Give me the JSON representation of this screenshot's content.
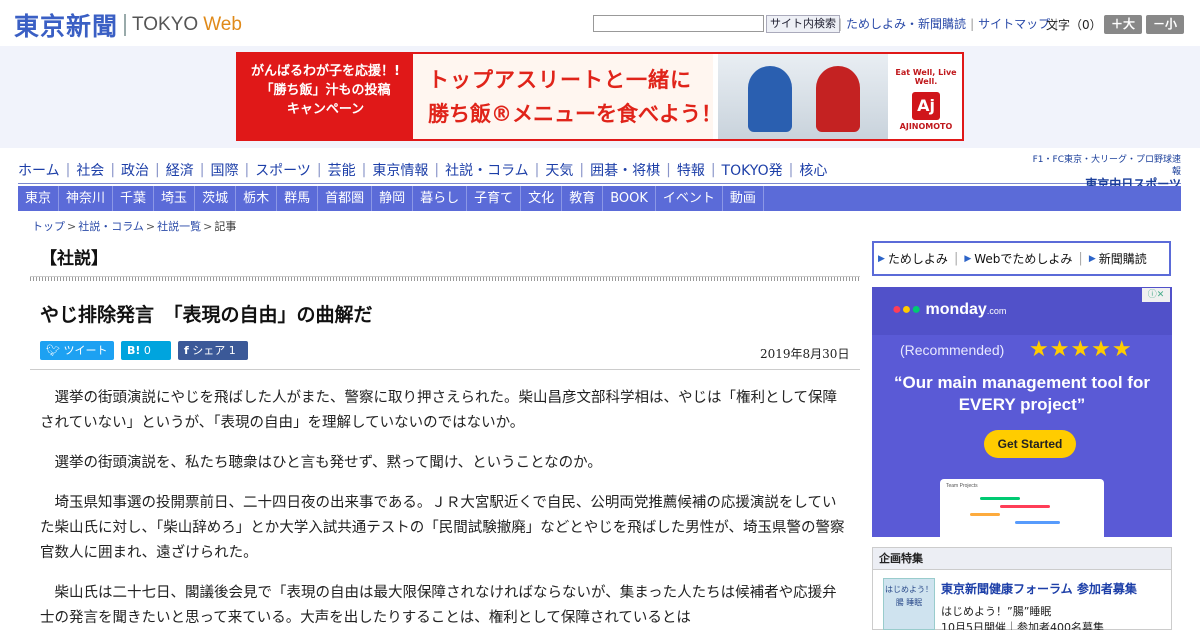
{
  "header": {
    "logo_jp": "東京新聞",
    "logo_en": "TOKYO",
    "logo_web": "Web",
    "search_button": "サイト内検索",
    "links": [
      "ためしよみ・新聞購読",
      "サイトマップ"
    ],
    "font_label": "文字（0）",
    "font_up": "＋大",
    "font_down": "－小"
  },
  "banner": {
    "left_lines": [
      "がんばるわが子を応援！!",
      "「勝ち飯」汁もの投稿",
      "キャンペーン"
    ],
    "headline": "トップアスリートと一緒に",
    "subline": "勝ち飯®メニューを食べよう！",
    "brand_slogan": "Eat Well, Live Well.",
    "brand_mark": "Aj",
    "brand_name": "AJINOMOTO"
  },
  "nav_primary": [
    "ホーム",
    "社会",
    "政治",
    "経済",
    "国際",
    "スポーツ",
    "芸能",
    "東京情報",
    "社説・コラム",
    "天気",
    "囲碁・将棋",
    "特報",
    "TOKYO発",
    "核心"
  ],
  "partner": {
    "line1": "F1・FC東京・大リーグ・プロ野球速報",
    "logo": "東京中日スポーツ"
  },
  "nav_secondary": [
    "東京",
    "神奈川",
    "千葉",
    "埼玉",
    "茨城",
    "栃木",
    "群馬",
    "首都圏",
    "静岡",
    "暮らし",
    "子育て",
    "文化",
    "教育",
    "BOOK",
    "イベント",
    "動画"
  ],
  "breadcrumb": [
    "トップ",
    "社説・コラム",
    "社説一覧",
    "記事"
  ],
  "article": {
    "section": "【社説】",
    "title": "やじ排除発言　「表現の自由」の曲解だ",
    "tweet_label": "ツイート",
    "hatena_label": "B!",
    "hatena_count": "0",
    "facebook_label": "シェア",
    "facebook_count": "1",
    "date": "2019年8月30日",
    "paragraphs": [
      "選挙の街頭演説にやじを飛ばした人がまた、警察に取り押さえられた。柴山昌彦文部科学相は、やじは「権利として保障されていない」というが、「表現の自由」を理解していないのではないか。",
      "選挙の街頭演説を、私たち聴衆はひと言も発せず、黙って聞け、ということなのか。",
      "埼玉県知事選の投開票前日、二十四日夜の出来事である。ＪＲ大宮駅近くで自民、公明両党推薦候補の応援演説をしていた柴山氏に対し、「柴山辞めろ」とか大学入試共通テストの「民間試験撤廃」などとやじを飛ばした男性が、埼玉県警の警察官数人に囲まれ、遠ざけられた。",
      "柴山氏は二十七日、閣議後会見で「表現の自由は最大限保障されなければならないが、集まった人たちは候補者や応援弁士の発言を聞きたいと思って来ている。大声を出したりすることは、権利として保障されているとは"
    ]
  },
  "sidebar": {
    "sub_links": [
      "ためしよみ",
      "Webでためしよみ",
      "新聞購読"
    ],
    "ad": {
      "logo": "monday",
      "logo_suffix": ".com",
      "recommended": "(Recommended)",
      "stars": "★★★★★",
      "quote": "“Our main management tool for EVERY project”",
      "button": "Get Started",
      "card_title": "Team Projects"
    },
    "feature": {
      "heading": "企画特集",
      "thumb_lines": [
        "はじめよう！",
        "腸 睡眠"
      ],
      "title": "東京新聞健康フォーラム 参加者募集",
      "sub": "はじめよう！”腸”睡眠",
      "sub2": "10月5日開催｜参加者400名募集"
    }
  }
}
